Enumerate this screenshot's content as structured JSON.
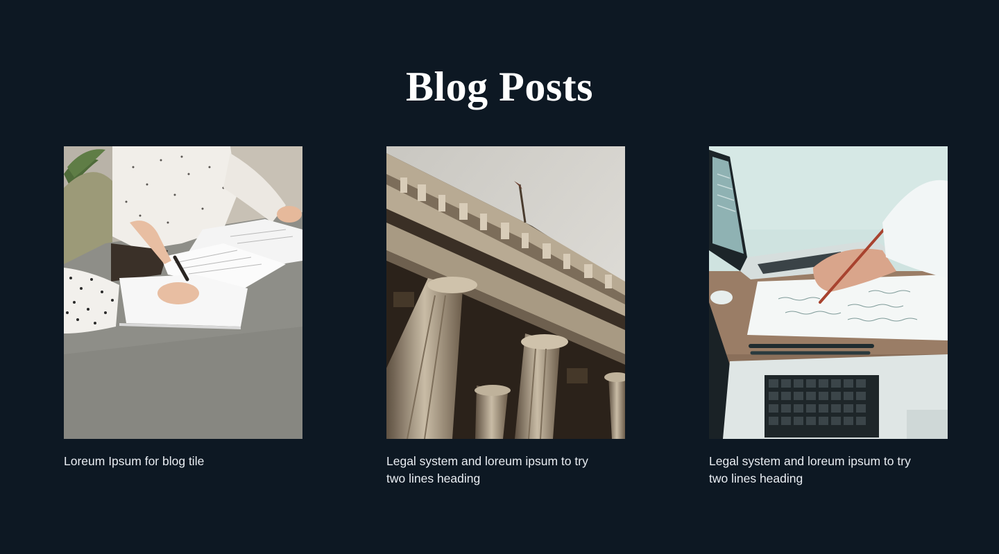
{
  "section": {
    "title": "Blog Posts"
  },
  "posts": [
    {
      "title": "Loreum Ipsum for blog tile",
      "image": "office-signing-photo"
    },
    {
      "title": "Legal system and loreum ipsum to try two lines heading",
      "image": "courthouse-columns-photo"
    },
    {
      "title": "Legal system and loreum ipsum to try two lines heading",
      "image": "laptop-notes-photo"
    }
  ],
  "colors": {
    "background": "#0d1823",
    "title": "#ffffff",
    "text": "#e9edf2"
  }
}
